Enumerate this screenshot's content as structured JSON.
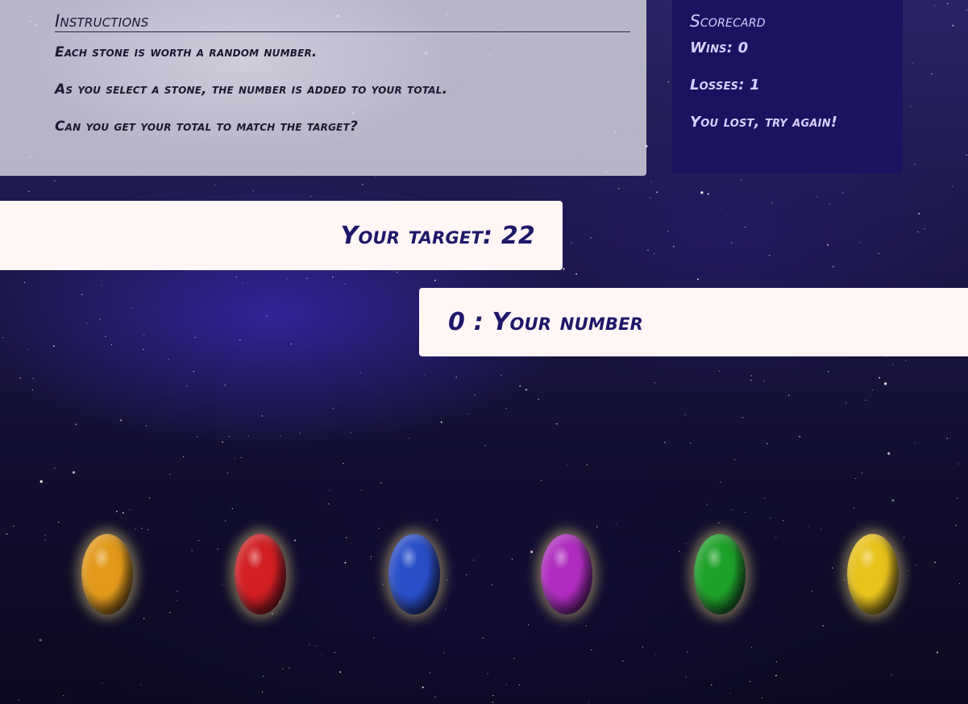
{
  "instructions": {
    "title": "Instructions",
    "lines": [
      "Each stone is worth a random number.",
      "As you select a stone, the number is added to your total.",
      "Can you get your total to match the target?"
    ]
  },
  "scorecard": {
    "title": "Scorecard",
    "wins": "Wins: 0",
    "losses": "Losses: 1",
    "message": "You lost, try again!"
  },
  "target": {
    "text": "Your target: 22"
  },
  "current": {
    "text": "0 : Your number"
  },
  "stones": [
    {
      "name": "orange-stone",
      "color": "#e39a1a"
    },
    {
      "name": "red-stone",
      "color": "#d21f24"
    },
    {
      "name": "blue-stone",
      "color": "#2a4fc8"
    },
    {
      "name": "purple-stone",
      "color": "#b02cc0"
    },
    {
      "name": "green-stone",
      "color": "#1fa22a"
    },
    {
      "name": "yellow-stone",
      "color": "#e8c31c"
    }
  ]
}
